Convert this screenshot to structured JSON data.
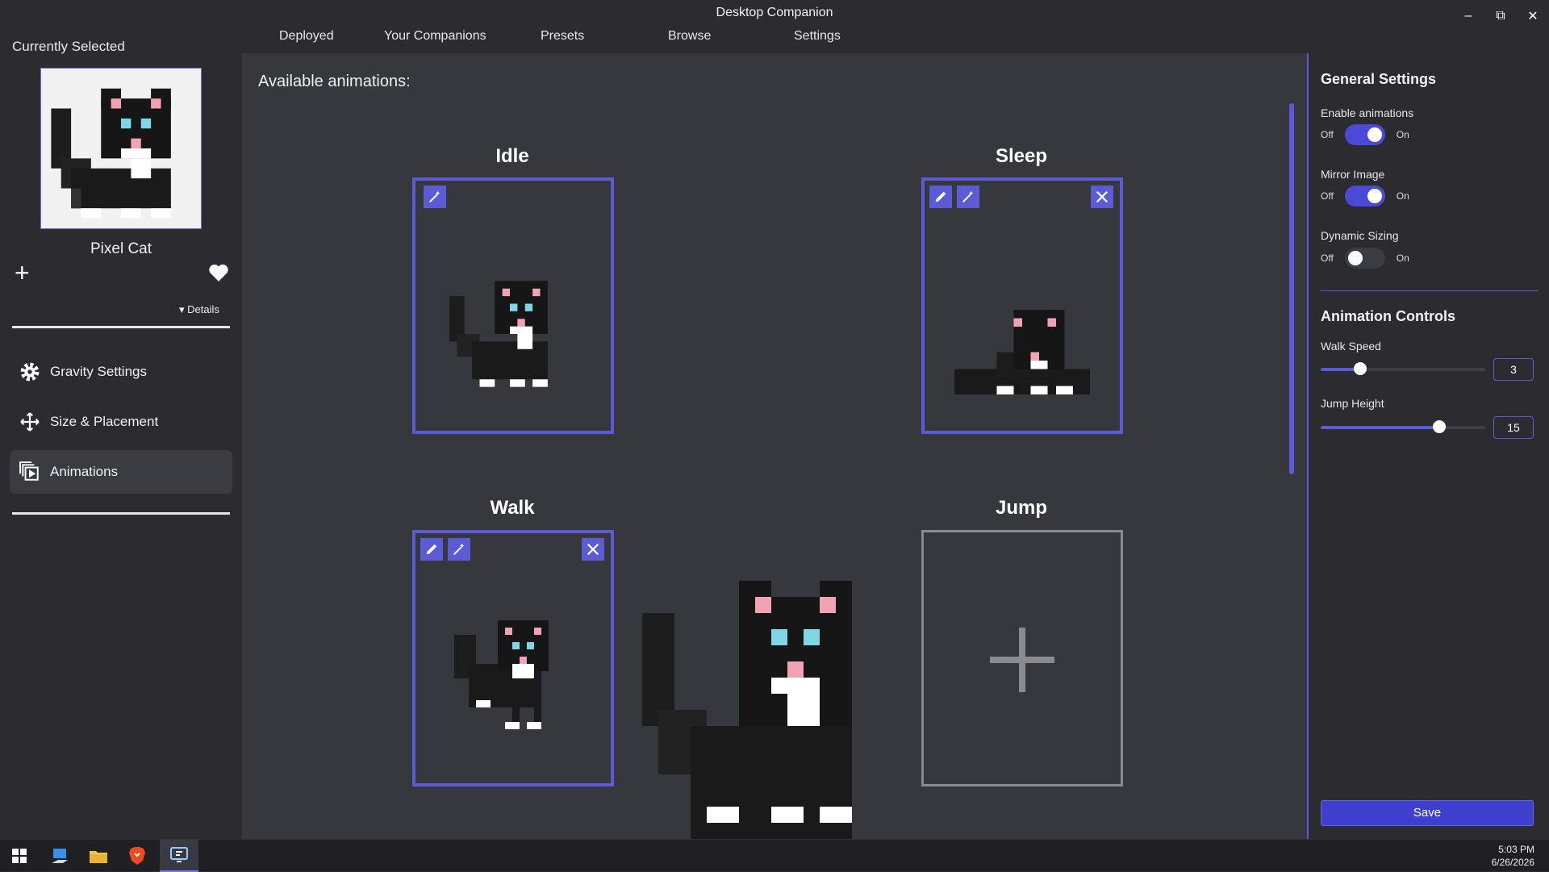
{
  "window": {
    "title": "Desktop Companion"
  },
  "topnav": {
    "items": [
      "Deployed",
      "Your Companions",
      "Presets",
      "Browse",
      "Settings"
    ]
  },
  "sidebar": {
    "currently_selected": "Currently Selected",
    "companion_name": "Pixel Cat",
    "details_label": "▾ Details",
    "items": [
      {
        "label": "Gravity Settings",
        "icon": "gear-icon"
      },
      {
        "label": "Size & Placement",
        "icon": "move-icon"
      },
      {
        "label": "Animations",
        "icon": "animations-icon",
        "active": true
      }
    ]
  },
  "main": {
    "heading": "Available animations:",
    "cards": [
      {
        "title": "Idle"
      },
      {
        "title": "Sleep"
      },
      {
        "title": "Walk"
      },
      {
        "title": "Jump"
      }
    ]
  },
  "settings": {
    "general_title": "General Settings",
    "toggles": [
      {
        "label": "Enable animations",
        "off": "Off",
        "on": "On",
        "value": true
      },
      {
        "label": "Mirror Image",
        "off": "Off",
        "on": "On",
        "value": true
      },
      {
        "label": "Dynamic Sizing",
        "off": "Off",
        "on": "On",
        "value": false
      }
    ],
    "animation_title": "Animation Controls",
    "walk_speed": {
      "label": "Walk Speed",
      "value": "3",
      "fraction": 0.24
    },
    "jump_height": {
      "label": "Jump Height",
      "value": "15",
      "fraction": 0.72
    },
    "save_label": "Save"
  },
  "taskbar": {
    "time": "5:03 PM",
    "date": "6/26/2026"
  },
  "colors": {
    "accent": "#5b5bd6",
    "bg": "#2b2b30",
    "panel": "#37373e"
  }
}
